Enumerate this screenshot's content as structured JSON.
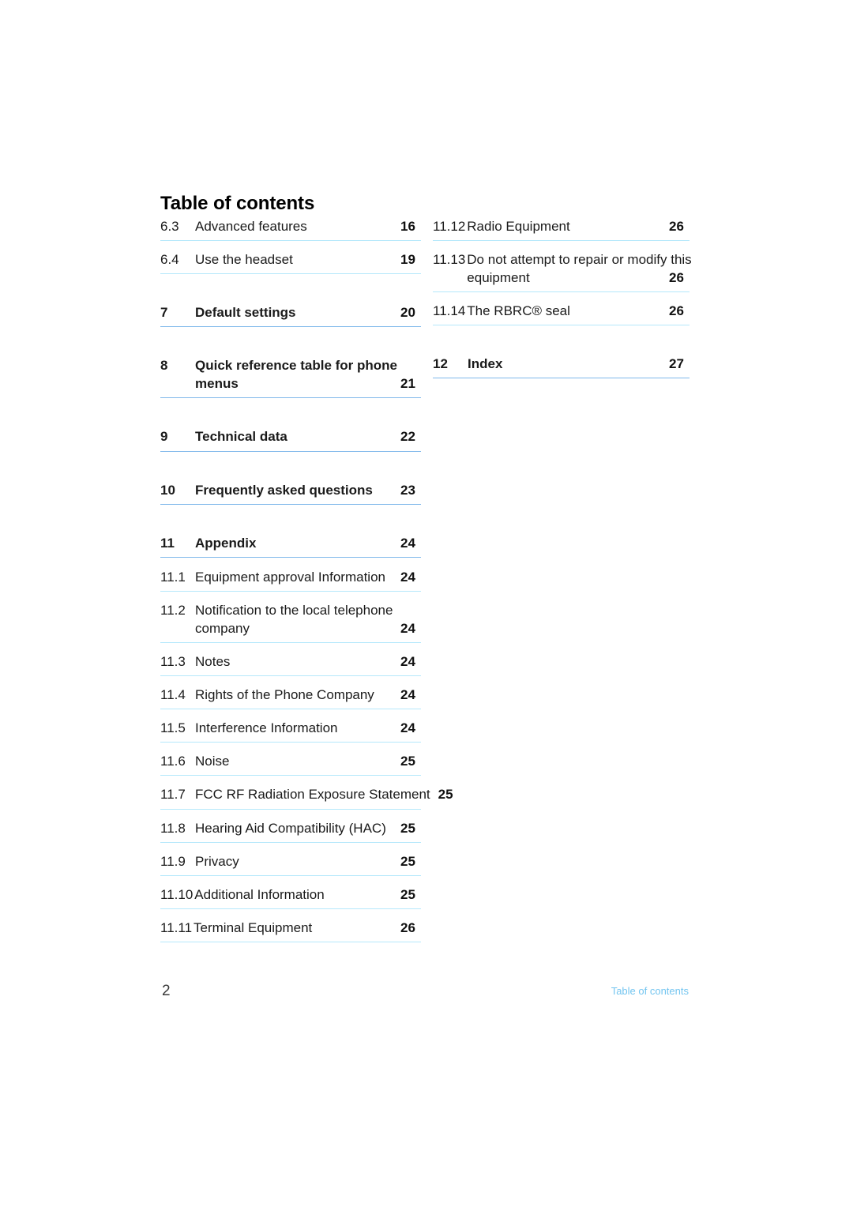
{
  "document": {
    "heading": "Table of contents",
    "footer_page_number": "2",
    "footer_label": "Table of contents",
    "rule_color_sub": "#b5e8fb",
    "rule_color_top": "#7fb8ea",
    "footer_label_color": "#73c5f0"
  },
  "columns": {
    "left": [
      {
        "number": "6.3",
        "title": "Advanced features",
        "page": "16",
        "level": "sub"
      },
      {
        "number": "6.4",
        "title": "Use the headset",
        "page": "19",
        "level": "sub"
      },
      {
        "number": "7",
        "title": "Default settings",
        "page": "20",
        "level": "top"
      },
      {
        "number": "8",
        "title": "Quick reference table for phone",
        "title_line2": "menus",
        "page": "21",
        "level": "top"
      },
      {
        "number": "9",
        "title": "Technical data",
        "page": "22",
        "level": "top"
      },
      {
        "number": "10",
        "title": "Frequently asked questions",
        "page": "23",
        "level": "top"
      },
      {
        "number": "11",
        "title": "Appendix",
        "page": "24",
        "level": "top"
      },
      {
        "number": "11.1",
        "title": "Equipment approval Information",
        "page": "24",
        "level": "sub"
      },
      {
        "number": "11.2",
        "title": "Notification to the local telephone",
        "title_line2": "company",
        "page": "24",
        "level": "sub"
      },
      {
        "number": "11.3",
        "title": "Notes",
        "page": "24",
        "level": "sub"
      },
      {
        "number": "11.4",
        "title": "Rights of the Phone Company",
        "page": "24",
        "level": "sub"
      },
      {
        "number": "11.5",
        "title": "Interference Information",
        "page": "24",
        "level": "sub"
      },
      {
        "number": "11.6",
        "title": "Noise",
        "page": "25",
        "level": "sub"
      },
      {
        "number": "11.7",
        "title": "FCC RF Radiation Exposure Statement",
        "page": "25",
        "level": "sub"
      },
      {
        "number": "11.8",
        "title": "Hearing Aid Compatibility (HAC)",
        "page": "25",
        "level": "sub"
      },
      {
        "number": "11.9",
        "title": "Privacy",
        "page": "25",
        "level": "sub"
      },
      {
        "number": "11.10",
        "title": "Additional Information",
        "page": "25",
        "level": "sub"
      },
      {
        "number": "11.11",
        "title": "Terminal Equipment",
        "page": "26",
        "level": "sub"
      }
    ],
    "right": [
      {
        "number": "11.12",
        "title": "Radio Equipment",
        "page": "26",
        "level": "sub"
      },
      {
        "number": "11.13",
        "title": "Do not attempt to repair or modify this",
        "title_line2": "equipment",
        "page": "26",
        "level": "sub"
      },
      {
        "number": "11.14",
        "title": "The RBRC® seal",
        "page": "26",
        "level": "sub"
      },
      {
        "number": "12",
        "title": "Index",
        "page": "27",
        "level": "top"
      }
    ]
  }
}
